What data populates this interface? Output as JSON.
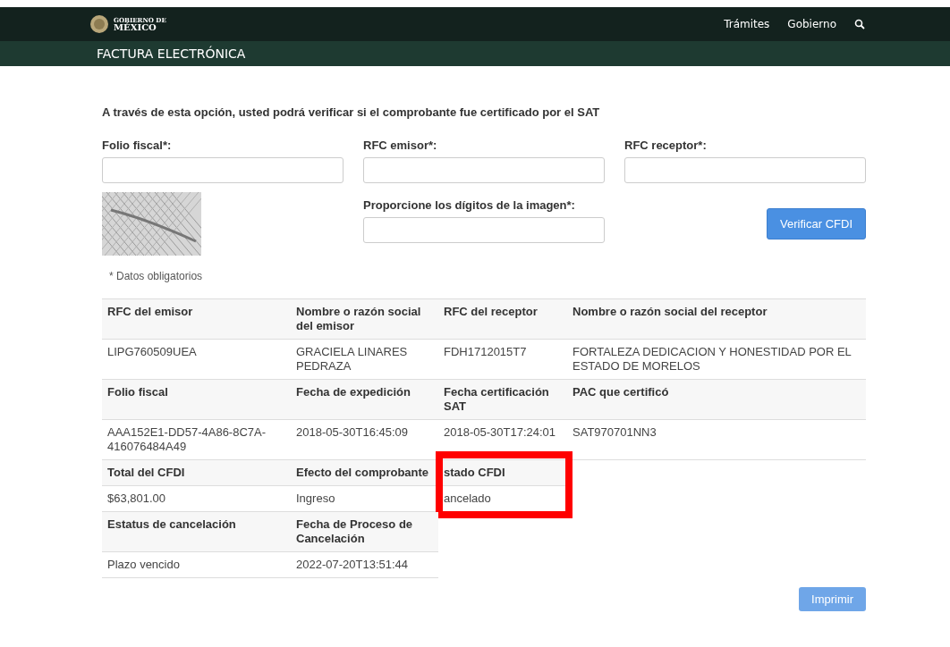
{
  "header": {
    "logo_lines": [
      "GOBIERNO DE",
      "MÉXICO"
    ],
    "nav": [
      "Trámites",
      "Gobierno"
    ],
    "section_title": "FACTURA ELECTRÓNICA"
  },
  "form": {
    "intro": "A través de esta opción, usted podrá verificar si el comprobante fue certificado por el SAT",
    "fields": [
      {
        "label": "Folio fiscal*:"
      },
      {
        "label": "RFC emisor*:"
      },
      {
        "label": "RFC receptor*:"
      }
    ],
    "captcha_label": "Proporcione los dígitos de la imagen*:",
    "verify_button": "Verificar CFDI",
    "note": "* Datos obligatorios"
  },
  "results": [
    {
      "rows": [
        {
          "kind": "header",
          "cells": [
            "RFC del emisor",
            "Nombre o razón social del emisor",
            "RFC del receptor",
            "Nombre o razón social del receptor"
          ]
        },
        {
          "kind": "data",
          "cells": [
            "LIPG760509UEA",
            "GRACIELA LINARES PEDRAZA",
            "FDH1712015T7",
            "FORTALEZA DEDICACION Y HONESTIDAD POR EL ESTADO DE MORELOS"
          ]
        },
        {
          "kind": "header",
          "cells": [
            "Folio fiscal",
            "Fecha de expedición",
            "Fecha certificación SAT",
            "PAC que certificó"
          ]
        },
        {
          "kind": "data",
          "cells": [
            "AAA152E1-DD57-4A86-8C7A-416076484A49",
            "2018-05-30T16:45:09",
            "2018-05-30T17:24:01",
            "SAT970701NN3"
          ]
        }
      ]
    },
    {
      "highlighted_last_column": true,
      "rows": [
        {
          "kind": "header",
          "cells": [
            "Total del CFDI",
            "Efecto del comprobante",
            "stado CFDI"
          ]
        },
        {
          "kind": "data",
          "cells": [
            "$63,801.00",
            "Ingreso",
            "ancelado"
          ]
        }
      ]
    },
    {
      "rows": [
        {
          "kind": "header",
          "cells": [
            "Estatus de cancelación",
            "Fecha de Proceso de Cancelación"
          ]
        },
        {
          "kind": "data",
          "cells": [
            "Plazo vencido",
            "2022-07-20T13:51:44"
          ]
        }
      ]
    }
  ],
  "print_button": "Imprimir"
}
